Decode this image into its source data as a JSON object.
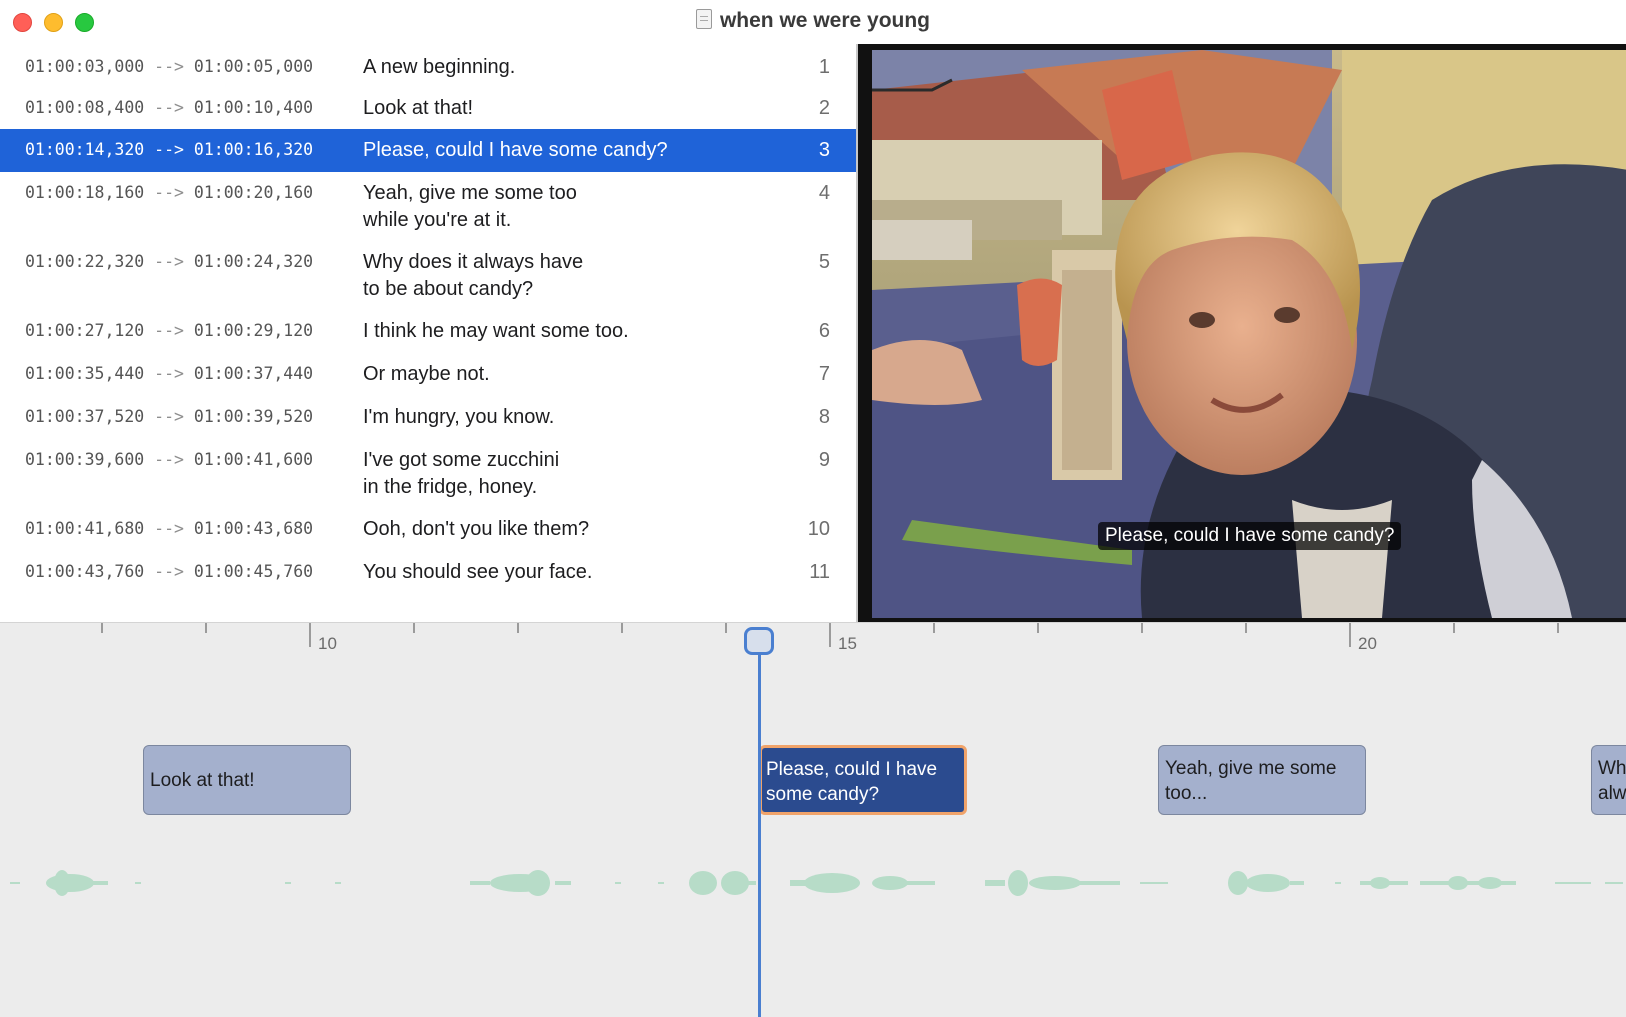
{
  "window": {
    "title": "when we were young"
  },
  "subtitles": [
    {
      "start": "01:00:03,000",
      "arrow": "-->",
      "end": "01:00:05,000",
      "text": "A new beginning.",
      "num": "1"
    },
    {
      "start": "01:00:08,400",
      "arrow": "-->",
      "end": "01:00:10,400",
      "text": "Look at that!",
      "num": "2"
    },
    {
      "start": "01:00:14,320",
      "arrow": "-->",
      "end": "01:00:16,320",
      "text": "Please, could I have some candy?",
      "num": "3"
    },
    {
      "start": "01:00:18,160",
      "arrow": "-->",
      "end": "01:00:20,160",
      "text": "Yeah, give me some too\nwhile you're at it.",
      "num": "4"
    },
    {
      "start": "01:00:22,320",
      "arrow": "-->",
      "end": "01:00:24,320",
      "text": "Why does it always have\nto be about candy?",
      "num": "5"
    },
    {
      "start": "01:00:27,120",
      "arrow": "-->",
      "end": "01:00:29,120",
      "text": "I think he may want some too.",
      "num": "6"
    },
    {
      "start": "01:00:35,440",
      "arrow": "-->",
      "end": "01:00:37,440",
      "text": "Or maybe not.",
      "num": "7"
    },
    {
      "start": "01:00:37,520",
      "arrow": "-->",
      "end": "01:00:39,520",
      "text": "I'm hungry, you know.",
      "num": "8"
    },
    {
      "start": "01:00:39,600",
      "arrow": "-->",
      "end": "01:00:41,600",
      "text": "I've got some zucchini\nin the fridge, honey.",
      "num": "9"
    },
    {
      "start": "01:00:41,680",
      "arrow": "-->",
      "end": "01:00:43,680",
      "text": "Ooh, don't you like them?",
      "num": "10"
    },
    {
      "start": "01:00:43,760",
      "arrow": "-->",
      "end": "01:00:45,760",
      "text": "You should see your face.",
      "num": "11"
    }
  ],
  "video": {
    "caption": "Please, could I have some candy?"
  },
  "timeline": {
    "labels": {
      "t10": "10",
      "t15": "15",
      "t20": "20"
    },
    "cues": {
      "look": "Look at that!",
      "candy": "Please, could I have some candy?",
      "yeah": "Yeah, give me some too...",
      "why": "Why does it always have"
    }
  },
  "colors": {
    "selection": "#1f63d8",
    "cue": "#a4b0cd",
    "active_cue": "#2b4b8f",
    "active_cue_border": "#f0a36a",
    "playhead": "#4a7fd0",
    "waveform": "#b7dcc8"
  }
}
